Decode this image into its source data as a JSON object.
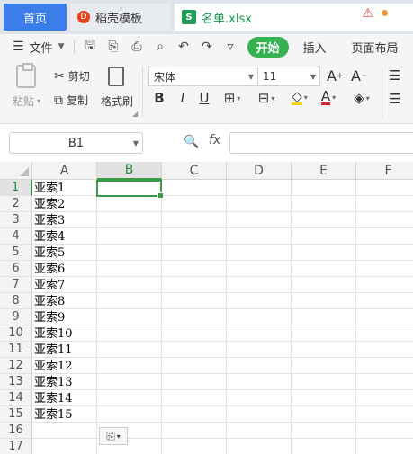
{
  "tabs": {
    "home": "首页",
    "template": "稻壳模板",
    "template_badge": "D",
    "file_badge": "S",
    "file": "名单.xlsx"
  },
  "menu": {
    "file": "文件",
    "start": "开始",
    "insert": "插入",
    "page_layout": "页面布局"
  },
  "ribbon": {
    "paste": "粘贴",
    "cut": "剪切",
    "copy": "复制",
    "format_painter": "格式刷",
    "font_name": "宋体",
    "font_size": "11"
  },
  "formula_bar": {
    "name_box": "B1",
    "fx": "fx",
    "formula": ""
  },
  "sheet": {
    "columns": [
      "A",
      "B",
      "C",
      "D",
      "E",
      "F"
    ],
    "selected_column": "B",
    "rows": [
      "1",
      "2",
      "3",
      "4",
      "5",
      "6",
      "7",
      "8",
      "9",
      "10",
      "11",
      "12",
      "13",
      "14",
      "15",
      "16",
      "17"
    ],
    "selected_row": "1",
    "col_a_values": [
      "亚索1",
      "亚索2",
      "亚索3",
      "亚索4",
      "亚索5",
      "亚索6",
      "亚索7",
      "亚索8",
      "亚索9",
      "亚索10",
      "亚索11",
      "亚索12",
      "亚索13",
      "亚索14",
      "亚索15"
    ],
    "active_cell": "B1"
  },
  "colors": {
    "accent_green": "#35b24f",
    "tab_blue": "#3b7de9",
    "selection_green": "#3a9a48"
  }
}
